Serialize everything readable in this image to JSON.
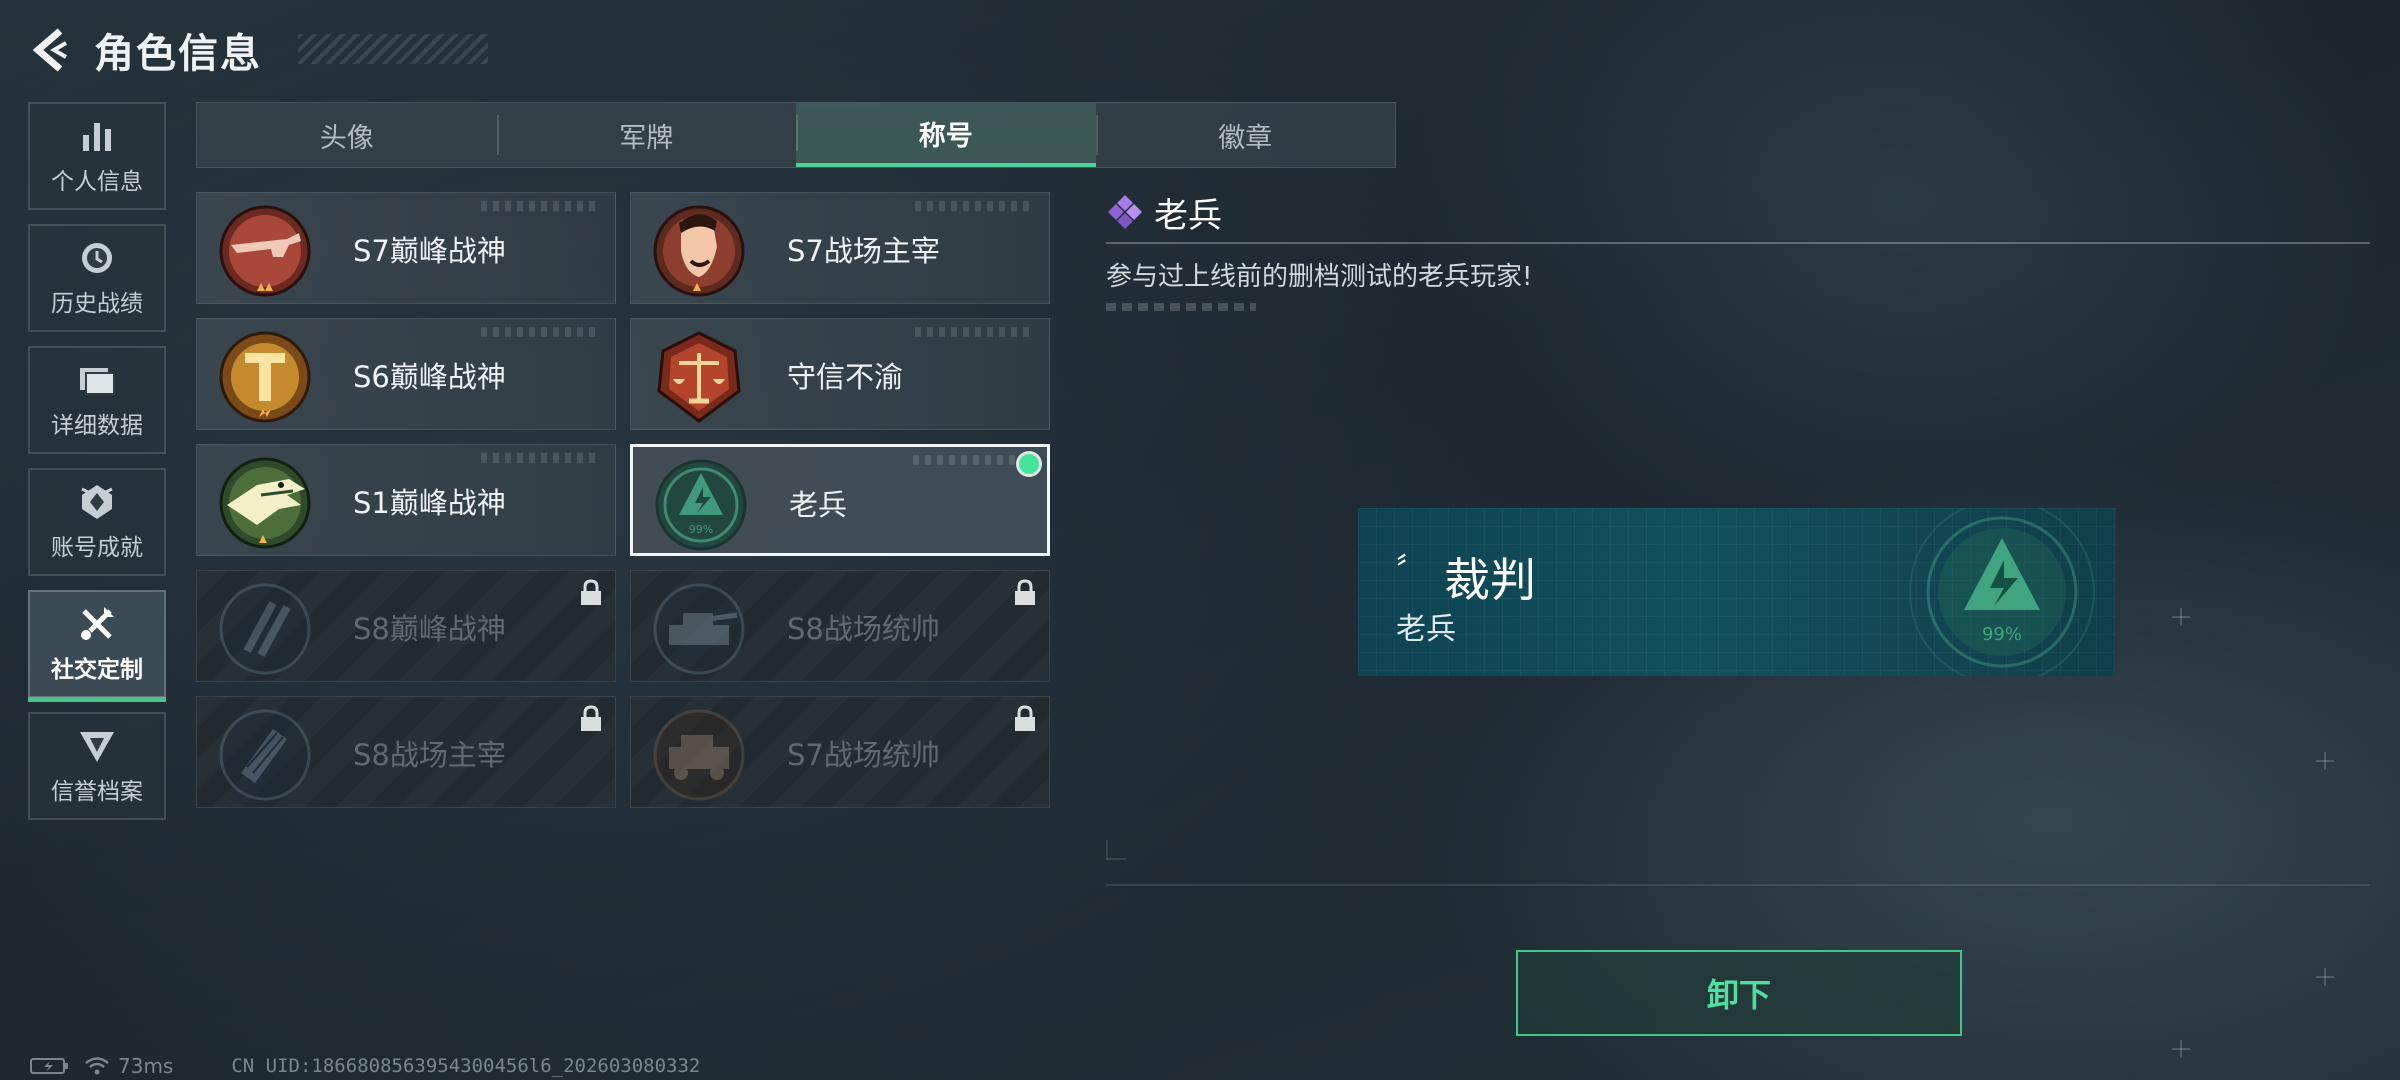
{
  "header": {
    "title": "角色信息"
  },
  "sidebar": {
    "items": [
      {
        "label": "个人信息",
        "icon": "bar-chart-icon",
        "active": false
      },
      {
        "label": "历史战绩",
        "icon": "clock-icon",
        "active": false
      },
      {
        "label": "详细数据",
        "icon": "folder-icon",
        "active": false
      },
      {
        "label": "账号成就",
        "icon": "achievement-icon",
        "active": false
      },
      {
        "label": "社交定制",
        "icon": "tools-icon",
        "active": true
      },
      {
        "label": "信誉档案",
        "icon": "credibility-icon",
        "active": false
      }
    ]
  },
  "tabs": [
    {
      "label": "头像",
      "active": false
    },
    {
      "label": "军牌",
      "active": false
    },
    {
      "label": "称号",
      "active": true
    },
    {
      "label": "徽章",
      "active": false
    }
  ],
  "titles": [
    {
      "label": "S7巅峰战神",
      "emblem": "gun-emblem-icon",
      "locked": false,
      "selected": false
    },
    {
      "label": "S7战场主宰",
      "emblem": "soldier-emblem-icon",
      "locked": false,
      "selected": false
    },
    {
      "label": "S6巅峰战神",
      "emblem": "t-shield-emblem-icon",
      "locked": false,
      "selected": false
    },
    {
      "label": "守信不渝",
      "emblem": "scales-emblem-icon",
      "locked": false,
      "selected": false
    },
    {
      "label": "S1巅峰战神",
      "emblem": "crocodile-emblem-icon",
      "locked": false,
      "selected": false
    },
    {
      "label": "老兵",
      "emblem": "veteran-emblem-icon",
      "locked": false,
      "selected": true,
      "emblem_text": "99%"
    },
    {
      "label": "S8巅峰战神",
      "emblem": "slash-emblem-icon",
      "locked": true,
      "selected": false
    },
    {
      "label": "S8战场统帅",
      "emblem": "tank-emblem-icon",
      "locked": true,
      "selected": false
    },
    {
      "label": "S8战场主宰",
      "emblem": "rocket-emblem-icon",
      "locked": true,
      "selected": false
    },
    {
      "label": "S7战场统帅",
      "emblem": "vehicle-emblem-icon",
      "locked": true,
      "selected": false
    }
  ],
  "detail": {
    "name": "老兵",
    "description": "参与过上线前的删档测试的老兵玩家!",
    "accent_color": "#9b6be0"
  },
  "preview": {
    "quote_mark": "〞",
    "player_name": "裁判",
    "title": "老兵",
    "emblem_text": "99%"
  },
  "actions": {
    "unequip_label": "卸下"
  },
  "status": {
    "ping": "73ms",
    "uid": "CN UID:1866808563954300456l6_202603080332"
  },
  "colors": {
    "accent_green": "#4fe09f",
    "selected_dot": "#44e39a",
    "preview_bg": "#12505c"
  }
}
